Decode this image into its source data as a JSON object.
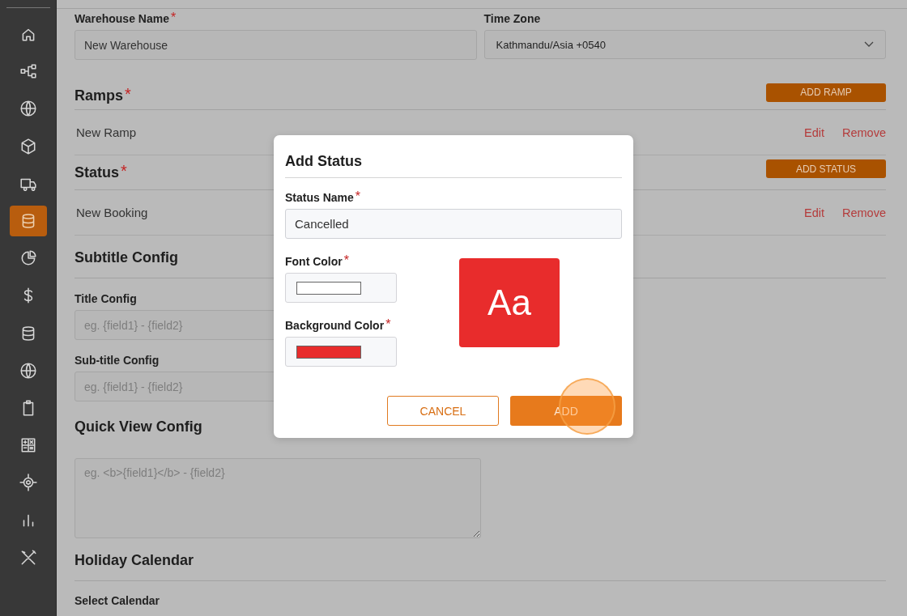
{
  "sidebar": {
    "items": [
      {
        "selected": false
      },
      {
        "selected": false
      },
      {
        "selected": false
      },
      {
        "selected": false
      },
      {
        "selected": false
      },
      {
        "selected": true
      },
      {
        "selected": false
      },
      {
        "selected": false
      },
      {
        "selected": false
      },
      {
        "selected": false
      },
      {
        "selected": false
      },
      {
        "selected": false
      },
      {
        "selected": false
      },
      {
        "selected": false
      },
      {
        "selected": false
      }
    ]
  },
  "warehouse_name": {
    "label": "Warehouse Name",
    "required_mark": "*",
    "value": "New Warehouse"
  },
  "time_zone": {
    "label": "Time Zone",
    "value": "Kathmandu/Asia +0540"
  },
  "ramps": {
    "title": "Ramps",
    "required_mark": "*",
    "add_button": "ADD RAMP",
    "rows": [
      {
        "name": "New Ramp",
        "edit": "Edit",
        "remove": "Remove"
      }
    ]
  },
  "status": {
    "title": "Status",
    "required_mark": "*",
    "add_button": "ADD STATUS",
    "rows": [
      {
        "name": "New Booking",
        "edit": "Edit",
        "remove": "Remove"
      }
    ]
  },
  "subtitle_config": {
    "title": "Subtitle Config",
    "fields": [
      {
        "label": "Title Config",
        "placeholder": "eg. {field1} - {field2}"
      },
      {
        "label": "Sub-title Config",
        "placeholder": "eg. {field1} - {field2}"
      }
    ]
  },
  "quick_view_config": {
    "title": "Quick View Config",
    "placeholder": "eg. <b>{field1}</b> - {field2}"
  },
  "holiday_calendar": {
    "title": "Holiday Calendar",
    "label": "Select Calendar"
  },
  "dialog": {
    "title": "Add Status",
    "status_name": {
      "label": "Status Name",
      "required_mark": "*",
      "value": "Cancelled"
    },
    "font_color": {
      "label": "Font Color",
      "required_mark": "*",
      "color": "#ffffff"
    },
    "background_color": {
      "label": "Background Color",
      "required_mark": "*",
      "color": "#e82c2c"
    },
    "preview": "Aa",
    "cancel": "CANCEL",
    "add": "ADD"
  }
}
